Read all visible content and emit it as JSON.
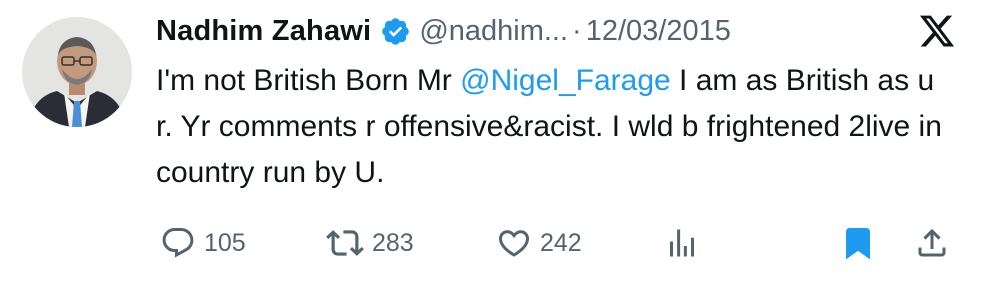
{
  "tweet": {
    "author_name": "Nadhim Zahawi",
    "handle": "@nadhim...",
    "separator": "·",
    "date": "12/03/2015",
    "text_before_mention": "I'm not British Born Mr ",
    "mention": "@Nigel_Farage",
    "text_after_mention": " I am as British as u r. Yr comments r offensive&racist. I wld b frightened 2live in country run by U."
  },
  "icons": {
    "verified": "verified-badge-icon",
    "logo": "x-logo-icon",
    "reply": "reply-icon",
    "retweet": "retweet-icon",
    "like": "like-icon",
    "views": "views-icon",
    "bookmark": "bookmark-icon",
    "share": "share-icon"
  },
  "actions": {
    "reply_count": "105",
    "retweet_count": "283",
    "like_count": "242"
  },
  "colors": {
    "accent": "#1d9bf0",
    "text_primary": "#0f1419",
    "text_secondary": "#536471",
    "bookmark_active": "#1d9bf0"
  }
}
